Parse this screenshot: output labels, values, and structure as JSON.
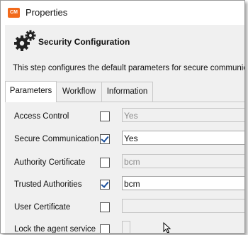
{
  "window": {
    "icon_text": "CM",
    "title": "Properties"
  },
  "header": {
    "icon": "gears-icon",
    "title": "Security Configuration",
    "description": "This step configures the default parameters for secure communicat"
  },
  "tabs": [
    {
      "label": "Parameters",
      "active": true
    },
    {
      "label": "Workflow",
      "active": false
    },
    {
      "label": "Information",
      "active": false
    }
  ],
  "parameters": [
    {
      "label": "Access Control",
      "checked": false,
      "value": "Yes",
      "enabled": false
    },
    {
      "label": "Secure Communication",
      "checked": true,
      "value": "Yes",
      "enabled": true
    },
    {
      "label": "Authority Certificate",
      "checked": false,
      "value": "bcm",
      "enabled": false
    },
    {
      "label": "Trusted Authorities",
      "checked": true,
      "value": "bcm",
      "enabled": true
    },
    {
      "label": "User Certificate",
      "checked": false,
      "value": "",
      "enabled": false
    },
    {
      "label": "Lock the agent service",
      "checked": false,
      "value": "",
      "enabled": false
    }
  ],
  "colors": {
    "app_icon": "#f26a1b",
    "panel_bg": "#f0f0f0",
    "check_mark": "#1a4f9c"
  }
}
